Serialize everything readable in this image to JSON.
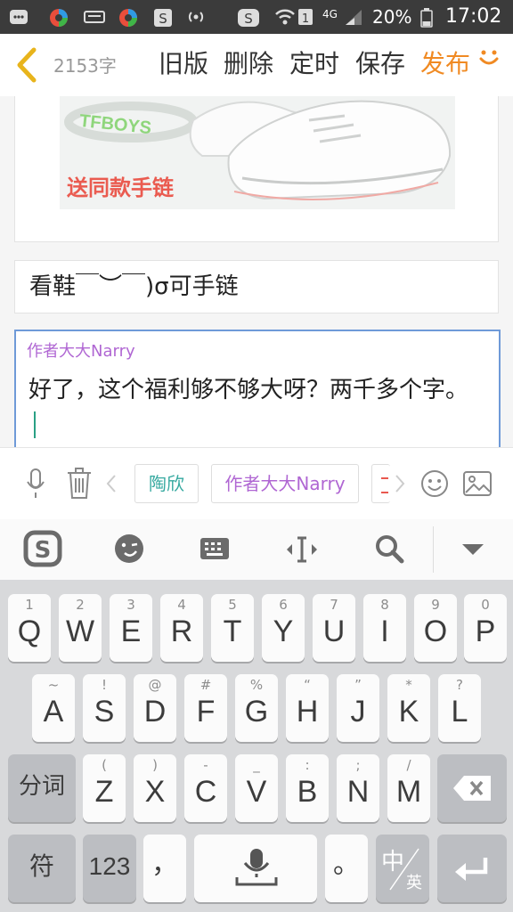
{
  "status_bar": {
    "net_type": "4G",
    "battery": "20%",
    "time": "17:02"
  },
  "header": {
    "char_count": "2153字",
    "buttons": [
      "旧版",
      "删除",
      "定时",
      "保存"
    ],
    "publish_label": "发布"
  },
  "content": {
    "image_brand": "TFBOYS",
    "image_caption": "送同款手链",
    "paragraph": "看鞋￣︶￣)σ可手链",
    "author_label": "作者大大Narry",
    "body_text": "好了，这个福利够不够大呀？两千多个字。"
  },
  "toolbar": {
    "tags": [
      "陶欣",
      "作者大大Narry"
    ]
  },
  "keyboard": {
    "row1": [
      {
        "sup": "1",
        "key": "Q"
      },
      {
        "sup": "2",
        "key": "W"
      },
      {
        "sup": "3",
        "key": "E"
      },
      {
        "sup": "4",
        "key": "R"
      },
      {
        "sup": "5",
        "key": "T"
      },
      {
        "sup": "6",
        "key": "Y"
      },
      {
        "sup": "7",
        "key": "U"
      },
      {
        "sup": "8",
        "key": "I"
      },
      {
        "sup": "9",
        "key": "O"
      },
      {
        "sup": "0",
        "key": "P"
      }
    ],
    "row2": [
      {
        "sup": "~",
        "key": "A"
      },
      {
        "sup": "!",
        "key": "S"
      },
      {
        "sup": "@",
        "key": "D"
      },
      {
        "sup": "#",
        "key": "F"
      },
      {
        "sup": "%",
        "key": "G"
      },
      {
        "sup": "“",
        "key": "H"
      },
      {
        "sup": "”",
        "key": "J"
      },
      {
        "sup": "*",
        "key": "K"
      },
      {
        "sup": "?",
        "key": "L"
      }
    ],
    "row3_left": "分词",
    "row3": [
      {
        "sup": "(",
        "key": "Z"
      },
      {
        "sup": ")",
        "key": "X"
      },
      {
        "sup": "-",
        "key": "C"
      },
      {
        "sup": "_",
        "key": "V"
      },
      {
        "sup": ":",
        "key": "B"
      },
      {
        "sup": ";",
        "key": "N"
      },
      {
        "sup": "/",
        "key": "M"
      }
    ],
    "symbol_key": "符",
    "num_key": "123",
    "comma_key": "，",
    "period_key": "。",
    "lang_key_main": "中",
    "lang_key_sub": "英"
  }
}
